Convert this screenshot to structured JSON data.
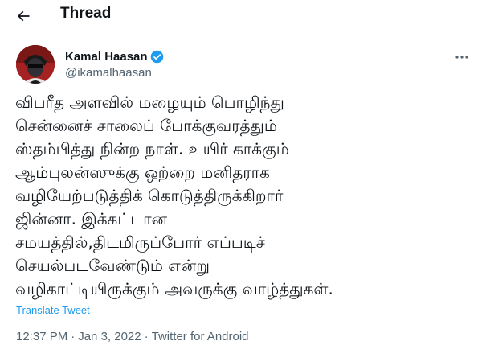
{
  "header": {
    "title": "Thread",
    "back_icon": "arrow-left-icon"
  },
  "tweet": {
    "author": {
      "name": "Kamal Haasan",
      "handle": "@ikamalhaasan",
      "verified": true,
      "avatar_icon": "profile-avatar"
    },
    "more_icon": "more-horizontal-icon",
    "lines": [
      "விபரீத அளவில் மழையும் பொழிந்து",
      "சென்னைச் சாலைப் போக்குவரத்தும்",
      "ஸ்தம்பித்து நின்ற நாள். உயிர் காக்கும்",
      "ஆம்புலன்ஸுக்கு ஒற்றை மனிதராக",
      "வழியேற்படுத்திக் கொடுத்திருக்கிறார்",
      "ஜின்னா. இக்கட்டான",
      "சமயத்தில்,திடமிருப்போர் எப்படிச்",
      "செயல்படவேண்டும் என்று",
      "வழிகாட்டியிருக்கும் அவருக்கு வாழ்த்துகள்."
    ],
    "translate_label": "Translate Tweet",
    "time": "12:37 PM",
    "date": "Jan 3, 2022",
    "source": "Twitter for Android",
    "separator": "·"
  },
  "colors": {
    "text_primary": "#0f1419",
    "text_secondary": "#536471",
    "accent": "#1d9bf0",
    "background": "#ffffff"
  }
}
